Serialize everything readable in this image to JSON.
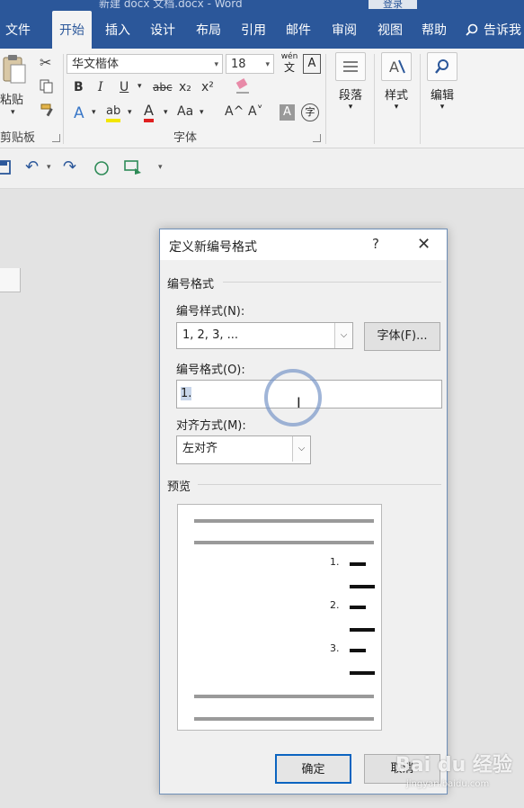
{
  "window": {
    "title": "新建 docx 文档.docx - Word",
    "account_button": "登录"
  },
  "tabs": [
    "文件",
    "开始",
    "插入",
    "设计",
    "布局",
    "引用",
    "邮件",
    "审阅",
    "视图",
    "帮助"
  ],
  "tell_me": "告诉我",
  "ribbon": {
    "paste_label": "粘贴",
    "clipboard_label": "剪贴板",
    "font_name": "华文楷体",
    "font_size": "18",
    "font_group_label": "字体",
    "paragraph_label": "段落",
    "styles_label": "样式",
    "editing_label": "编辑",
    "wen_top": "wén",
    "wen_bottom": "文",
    "char_border": "A",
    "bold": "B",
    "italic": "I",
    "underline": "U",
    "strike": "abc",
    "subscript": "x₂",
    "superscript": "x²",
    "text_effects": "A",
    "highlight": "ab",
    "font_color": "A",
    "change_case": "Aa",
    "grow_font": "A^",
    "shrink_font": "A˅",
    "char_shading": "A",
    "enclose": "字"
  },
  "colors": {
    "accent": "#2b579a",
    "dialog_focus": "#0b64c0"
  },
  "dialog": {
    "title": "定义新编号格式",
    "help": "?",
    "close": "✕",
    "number_format_section": "编号格式",
    "number_style_label": "编号样式(N):",
    "number_style_value": "1, 2, 3, ...",
    "font_button": "字体(F)...",
    "number_format_label": "编号格式(O):",
    "number_format_value": "1.",
    "alignment_label": "对齐方式(M):",
    "alignment_value": "左对齐",
    "preview_section": "预览",
    "preview_numbers": [
      "1.",
      "2.",
      "3."
    ],
    "ok": "确定",
    "cancel": "取消"
  },
  "watermark": {
    "brand": "Bai du 经验",
    "url": "jingyan.baidu.com"
  }
}
